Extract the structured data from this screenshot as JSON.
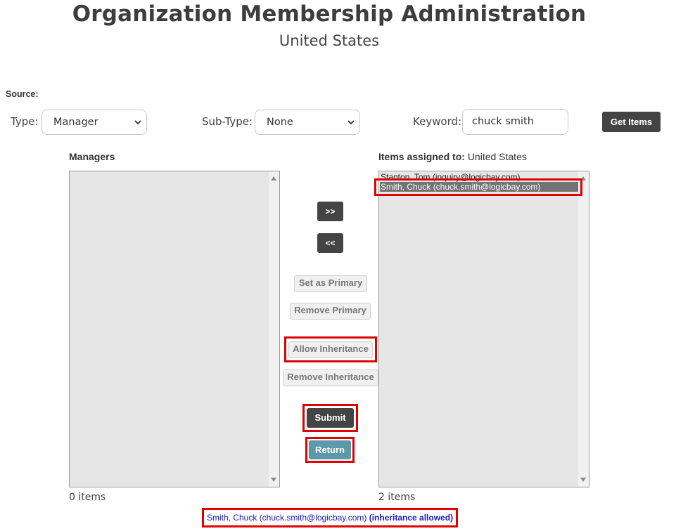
{
  "header": {
    "title": "Organization Membership Administration",
    "subtitle": "United States"
  },
  "source": {
    "label": "Source:",
    "type_label": "Type:",
    "type_value": "Manager",
    "subtype_label": "Sub-Type:",
    "subtype_value": "None",
    "keyword_label": "Keyword:",
    "keyword_value": "chuck smith",
    "get_items_label": "Get Items"
  },
  "left_list": {
    "label": "Managers",
    "items": [],
    "count_text": "0 items"
  },
  "right_list": {
    "label_bold": "Items assigned to:",
    "label_value": "United States",
    "items": [
      {
        "text": "Stanton, Tom (inquiry@logicbay.com)",
        "selected": false
      },
      {
        "text": "Smith, Chuck (chuck.smith@logicbay.com)",
        "selected": true
      }
    ],
    "count_text": "2 items"
  },
  "actions": {
    "add_label": ">>",
    "remove_label": "<<",
    "set_primary_label": "Set as Primary",
    "remove_primary_label": "Remove Primary",
    "allow_inheritance_label": "Allow Inheritance",
    "remove_inheritance_label": "Remove Inheritance",
    "submit_label": "Submit",
    "return_label": "Return"
  },
  "status": {
    "name": "Smith, Chuck (chuck.smith@logicbay.com)",
    "note": "(inheritance allowed)"
  },
  "colors": {
    "highlight": "#e00000",
    "dark_button": "#444444",
    "return_button": "#5b9aaa",
    "status_text": "#1a1acc",
    "selected_item": "#737373"
  }
}
